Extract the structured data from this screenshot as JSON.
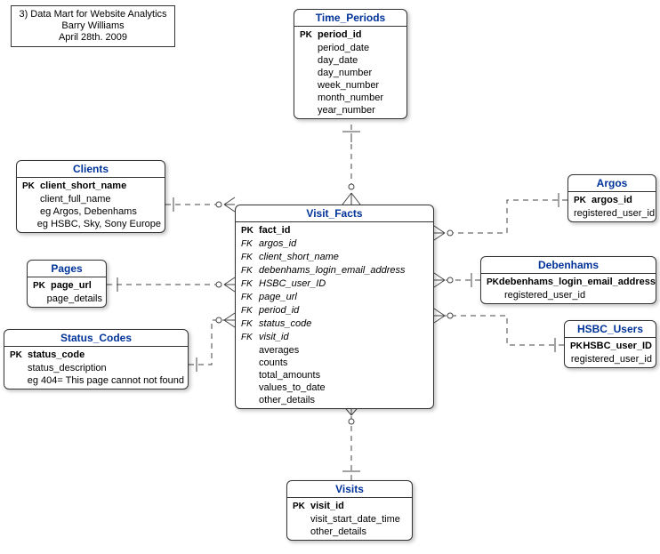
{
  "info": {
    "line1": "3)  Data Mart for Website Analytics",
    "line2": "Barry Williams",
    "line3": "April 28th. 2009"
  },
  "entities": {
    "time_periods": {
      "title": "Time_Periods",
      "rows": [
        {
          "key": "PK",
          "name": "period_id",
          "pk": true
        },
        {
          "key": "",
          "name": "period_date"
        },
        {
          "key": "",
          "name": "day_date"
        },
        {
          "key": "",
          "name": "day_number"
        },
        {
          "key": "",
          "name": "week_number"
        },
        {
          "key": "",
          "name": "month_number"
        },
        {
          "key": "",
          "name": "year_number"
        }
      ]
    },
    "clients": {
      "title": "Clients",
      "rows": [
        {
          "key": "PK",
          "name": "client_short_name",
          "pk": true
        },
        {
          "key": "",
          "name": "client_full_name"
        },
        {
          "key": "",
          "name": "eg Argos, Debenhams"
        },
        {
          "key": "",
          "name": "eg HSBC, Sky, Sony Europe"
        }
      ]
    },
    "pages": {
      "title": "Pages",
      "rows": [
        {
          "key": "PK",
          "name": "page_url",
          "pk": true
        },
        {
          "key": "",
          "name": "page_details"
        }
      ]
    },
    "status_codes": {
      "title": "Status_Codes",
      "rows": [
        {
          "key": "PK",
          "name": "status_code",
          "pk": true
        },
        {
          "key": "",
          "name": "status_description"
        },
        {
          "key": "",
          "name": "eg 404= This page cannot not found"
        }
      ]
    },
    "visit_facts": {
      "title": "Visit_Facts",
      "rows": [
        {
          "key": "PK",
          "name": "fact_id",
          "pk": true
        },
        {
          "key": "FK",
          "name": "argos_id",
          "fk": true
        },
        {
          "key": "FK",
          "name": "client_short_name",
          "fk": true
        },
        {
          "key": "FK",
          "name": "debenhams_login_email_address",
          "fk": true
        },
        {
          "key": "FK",
          "name": "HSBC_user_ID",
          "fk": true
        },
        {
          "key": "FK",
          "name": "page_url",
          "fk": true
        },
        {
          "key": "FK",
          "name": "period_id",
          "fk": true
        },
        {
          "key": "FK",
          "name": "status_code",
          "fk": true
        },
        {
          "key": "FK",
          "name": "visit_id",
          "fk": true
        },
        {
          "key": "",
          "name": "averages"
        },
        {
          "key": "",
          "name": "counts"
        },
        {
          "key": "",
          "name": "total_amounts"
        },
        {
          "key": "",
          "name": "values_to_date"
        },
        {
          "key": "",
          "name": "other_details"
        }
      ]
    },
    "argos": {
      "title": "Argos",
      "rows": [
        {
          "key": "PK",
          "name": "argos_id",
          "pk": true
        },
        {
          "key": "",
          "name": "registered_user_id"
        }
      ]
    },
    "debenhams": {
      "title": "Debenhams",
      "rows": [
        {
          "key": "PK",
          "name": "debenhams_login_email_address",
          "pk": true
        },
        {
          "key": "",
          "name": "registered_user_id"
        }
      ]
    },
    "hsbc": {
      "title": "HSBC_Users",
      "rows": [
        {
          "key": "PK",
          "name": "HSBC_user_ID",
          "pk": true
        },
        {
          "key": "",
          "name": "registered_user_id"
        }
      ]
    },
    "visits": {
      "title": "Visits",
      "rows": [
        {
          "key": "PK",
          "name": "visit_id",
          "pk": true
        },
        {
          "key": "",
          "name": "visit_start_date_time"
        },
        {
          "key": "",
          "name": "other_details"
        }
      ]
    }
  }
}
